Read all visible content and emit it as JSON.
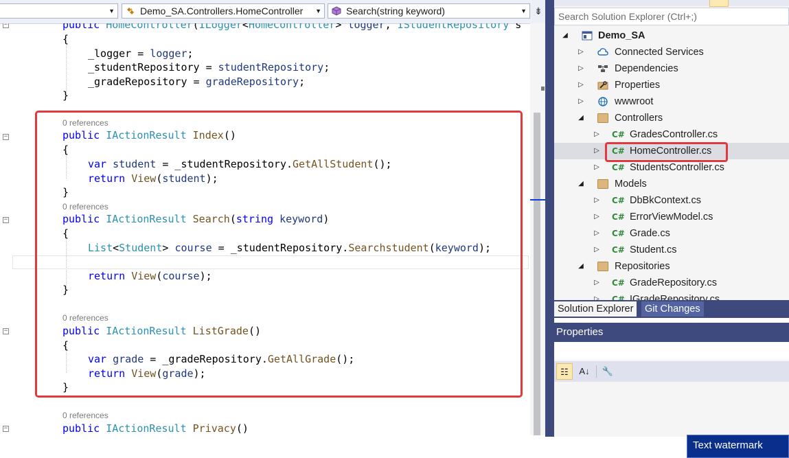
{
  "navbar": {
    "context_combo": "",
    "class_combo": "Demo_SA.Controllers.HomeController",
    "member_combo": "Search(string keyword)",
    "split_glyph": "⇟"
  },
  "code": {
    "lines": {
      "ctor": [
        {
          "t": "public ",
          "c": "kw"
        },
        {
          "t": "HomeController",
          "c": "ty"
        },
        {
          "t": "(",
          "c": "pl"
        },
        {
          "t": "ILogger",
          "c": "ty"
        },
        {
          "t": "<",
          "c": "pl"
        },
        {
          "t": "HomeController",
          "c": "ty"
        },
        {
          "t": "> ",
          "c": "pl"
        },
        {
          "t": "logger",
          "c": "pm"
        },
        {
          "t": ", ",
          "c": "pl"
        },
        {
          "t": "IStudentRepository",
          "c": "ty"
        },
        {
          "t": " s",
          "c": "pl"
        }
      ],
      "open1": [
        {
          "t": "{",
          "c": "pl"
        }
      ],
      "l_logger": [
        {
          "t": "_logger = ",
          "c": "pl"
        },
        {
          "t": "logger",
          "c": "pm"
        },
        {
          "t": ";",
          "c": "pl"
        }
      ],
      "l_studrepo": [
        {
          "t": "_studentRepository = ",
          "c": "pl"
        },
        {
          "t": "studentRepository",
          "c": "pm"
        },
        {
          "t": ";",
          "c": "pl"
        }
      ],
      "l_graderepo": [
        {
          "t": "_gradeRepository = ",
          "c": "pl"
        },
        {
          "t": "gradeRepository",
          "c": "pm"
        },
        {
          "t": ";",
          "c": "pl"
        }
      ],
      "close1": [
        {
          "t": "}",
          "c": "pl"
        }
      ],
      "index_sig": [
        {
          "t": "public ",
          "c": "kw"
        },
        {
          "t": "IActionResult ",
          "c": "ty"
        },
        {
          "t": "Index",
          "c": "mt"
        },
        {
          "t": "()",
          "c": "pl"
        }
      ],
      "open2": [
        {
          "t": "{",
          "c": "pl"
        }
      ],
      "index_var": [
        {
          "t": "var ",
          "c": "kw"
        },
        {
          "t": "student",
          "c": "pm"
        },
        {
          "t": " = _studentRepository.",
          "c": "pl"
        },
        {
          "t": "GetAllStudent",
          "c": "mt"
        },
        {
          "t": "();",
          "c": "pl"
        }
      ],
      "index_ret": [
        {
          "t": "return ",
          "c": "kw"
        },
        {
          "t": "View",
          "c": "mt"
        },
        {
          "t": "(",
          "c": "pl"
        },
        {
          "t": "student",
          "c": "pm"
        },
        {
          "t": ");",
          "c": "pl"
        }
      ],
      "close2": [
        {
          "t": "}",
          "c": "pl"
        }
      ],
      "search_sig": [
        {
          "t": "public ",
          "c": "kw"
        },
        {
          "t": "IActionResult ",
          "c": "ty"
        },
        {
          "t": "Search",
          "c": "mt"
        },
        {
          "t": "(",
          "c": "pl"
        },
        {
          "t": "string ",
          "c": "kw"
        },
        {
          "t": "keyword",
          "c": "pm"
        },
        {
          "t": ")",
          "c": "pl"
        }
      ],
      "open3": [
        {
          "t": "{",
          "c": "pl"
        }
      ],
      "search_list": [
        {
          "t": "List",
          "c": "ty"
        },
        {
          "t": "<",
          "c": "pl"
        },
        {
          "t": "Student",
          "c": "ty"
        },
        {
          "t": "> ",
          "c": "pl"
        },
        {
          "t": "course",
          "c": "pm"
        },
        {
          "t": " = _studentRepository.",
          "c": "pl"
        },
        {
          "t": "Searchstudent",
          "c": "mt"
        },
        {
          "t": "(",
          "c": "pl"
        },
        {
          "t": "keyword",
          "c": "pm"
        },
        {
          "t": ");",
          "c": "pl"
        }
      ],
      "search_ret": [
        {
          "t": "return ",
          "c": "kw"
        },
        {
          "t": "View",
          "c": "mt"
        },
        {
          "t": "(",
          "c": "pl"
        },
        {
          "t": "course",
          "c": "pm"
        },
        {
          "t": ");",
          "c": "pl"
        }
      ],
      "close3": [
        {
          "t": "}",
          "c": "pl"
        }
      ],
      "lg_sig": [
        {
          "t": "public ",
          "c": "kw"
        },
        {
          "t": "IActionResult ",
          "c": "ty"
        },
        {
          "t": "ListGrade",
          "c": "mt"
        },
        {
          "t": "()",
          "c": "pl"
        }
      ],
      "open4": [
        {
          "t": "{",
          "c": "pl"
        }
      ],
      "lg_var": [
        {
          "t": "var ",
          "c": "kw"
        },
        {
          "t": "grade",
          "c": "pm"
        },
        {
          "t": " = _gradeRepository.",
          "c": "pl"
        },
        {
          "t": "GetAllGrade",
          "c": "mt"
        },
        {
          "t": "();",
          "c": "pl"
        }
      ],
      "lg_ret": [
        {
          "t": "return ",
          "c": "kw"
        },
        {
          "t": "View",
          "c": "mt"
        },
        {
          "t": "(",
          "c": "pl"
        },
        {
          "t": "grade",
          "c": "pm"
        },
        {
          "t": ");",
          "c": "pl"
        }
      ],
      "close4": [
        {
          "t": "}",
          "c": "pl"
        }
      ],
      "priv_sig": [
        {
          "t": "public ",
          "c": "kw"
        },
        {
          "t": "IActionResult ",
          "c": "ty"
        },
        {
          "t": "Privacy",
          "c": "mt"
        },
        {
          "t": "()",
          "c": "pl"
        }
      ]
    },
    "ref_index": "0 references",
    "ref_search": "0 references",
    "ref_listgrade": "0 references",
    "ref_privacy": "0 references",
    "fold_glyph": "−"
  },
  "solution_explorer": {
    "search_placeholder": "Search Solution Explorer (Ctrl+;)",
    "project": "Demo_SA",
    "connected_services": "Connected Services",
    "dependencies": "Dependencies",
    "properties": "Properties",
    "wwwroot": "wwwroot",
    "controllers": "Controllers",
    "grades_controller": "GradesController.cs",
    "home_controller": "HomeController.cs",
    "students_controller": "StudentsController.cs",
    "models": "Models",
    "dbbk": "DbBkContext.cs",
    "errorvm": "ErrorViewModel.cs",
    "grade": "Grade.cs",
    "student": "Student.cs",
    "repositories": "Repositories",
    "grade_repo": "GradeRepository.cs",
    "igrade_repo": "IGradeRepository.cs",
    "cs_badge": "C#",
    "expanded_glyph": "◢",
    "collapsed_glyph": "▷"
  },
  "tabs": {
    "solution_explorer": "Solution Explorer",
    "git_changes": "Git Changes"
  },
  "properties_panel": {
    "title": "Properties",
    "categorized_glyph": "☷",
    "alpha_glyph": "A↓",
    "pages_glyph": "🔧"
  },
  "watermark": "Text watermark",
  "colors": {
    "accent_red": "#e0393e",
    "panel_header": "#3e4a7e",
    "keyword": "#0000ff",
    "type": "#2b91af",
    "method": "#74531f",
    "param": "#1f377f"
  }
}
